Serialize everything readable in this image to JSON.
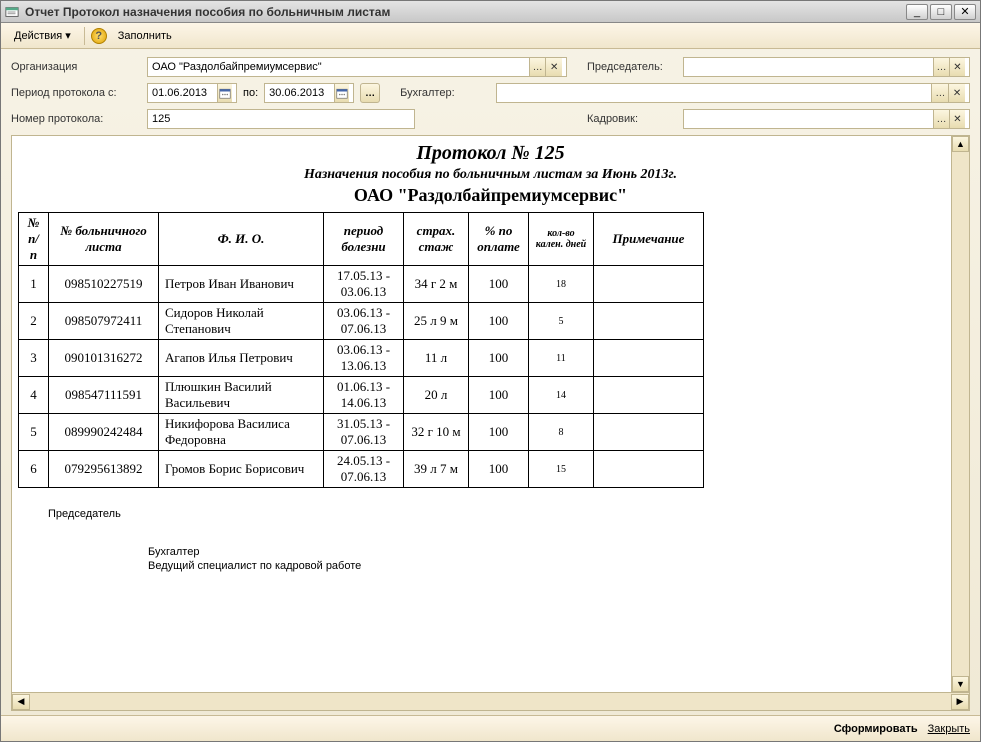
{
  "window": {
    "title": "Отчет  Протокол назначения пособия по больничным листам"
  },
  "toolbar": {
    "actions_label": "Действия",
    "fill_label": "Заполнить"
  },
  "form": {
    "org_label": "Организация",
    "org_value": "ОАО \"Раздолбайпремиумсервис\"",
    "period_label": "Период протокола с:",
    "period_from": "01.06.2013",
    "period_to_label": "по:",
    "period_to": "30.06.2013",
    "num_label": "Номер протокола:",
    "num_value": "125",
    "chairman_label": "Председатель:",
    "accountant_label": "Бухгалтер:",
    "hr_label": "Кадровик:"
  },
  "report": {
    "title": "Протокол № 125",
    "subtitle": "Назначения пособия по больничным листам за Июнь 2013г.",
    "org": "ОАО \"Раздолбайпремиумсервис\"",
    "headers": {
      "np": "№ п/п",
      "num": "№ больничного листа",
      "fio": "Ф. И. О.",
      "period": "период болезни",
      "staj": "страх. стаж",
      "pay": "% по оплате",
      "days": "кол-во кален. дней",
      "note": "Примечание"
    },
    "rows": [
      {
        "n": "1",
        "num": "098510227519",
        "fio": "Петров Иван Иванович",
        "period": "17.05.13 - 03.06.13",
        "staj": "34 г 2 м",
        "pay": "100",
        "days": "18",
        "note": ""
      },
      {
        "n": "2",
        "num": "098507972411",
        "fio": "Сидоров Николай Степанович",
        "period": "03.06.13 - 07.06.13",
        "staj": "25 л 9 м",
        "pay": "100",
        "days": "5",
        "note": ""
      },
      {
        "n": "3",
        "num": "090101316272",
        "fio": "Агапов Илья Петрович",
        "period": "03.06.13 - 13.06.13",
        "staj": "11 л",
        "pay": "100",
        "days": "11",
        "note": ""
      },
      {
        "n": "4",
        "num": "098547111591",
        "fio": "Плюшкин Василий Васильевич",
        "period": "01.06.13 - 14.06.13",
        "staj": "20 л",
        "pay": "100",
        "days": "14",
        "note": ""
      },
      {
        "n": "5",
        "num": "089990242484",
        "fio": "Никифорова Василиса Федоровна",
        "period": "31.05.13 - 07.06.13",
        "staj": "32 г 10 м",
        "pay": "100",
        "days": "8",
        "note": ""
      },
      {
        "n": "6",
        "num": "079295613892",
        "fio": "Громов Борис Борисович",
        "period": "24.05.13 - 07.06.13",
        "staj": "39 л 7 м",
        "pay": "100",
        "days": "15",
        "note": ""
      }
    ],
    "signatures": {
      "chairman": "Председатель",
      "accountant": "Бухгалтер",
      "hr": "Ведущий  специалист по кадровой работе"
    }
  },
  "footer": {
    "generate": "Сформировать",
    "close": "Закрыть"
  }
}
